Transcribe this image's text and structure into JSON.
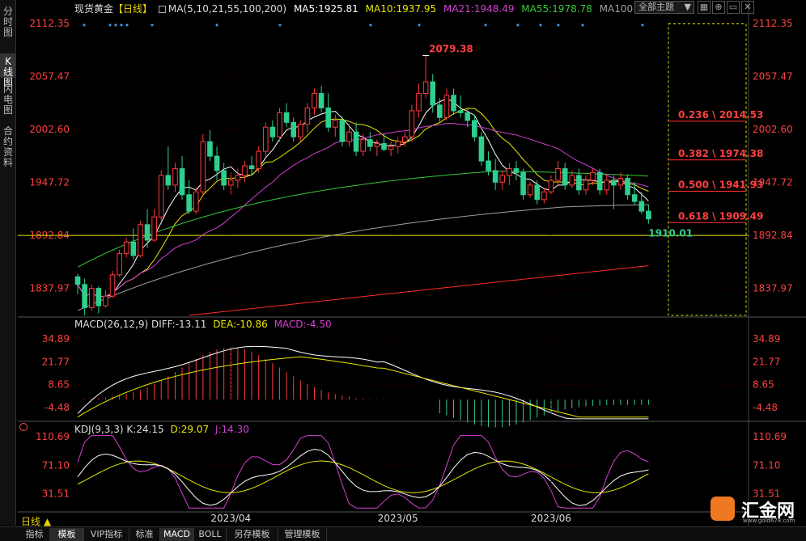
{
  "left_tabs": [
    {
      "label": "分时图",
      "active": false
    },
    {
      "label": "K线图",
      "active": true
    },
    {
      "label": "闪电图",
      "active": false
    },
    {
      "label": "合约资料",
      "active": false
    }
  ],
  "legend": {
    "symbol": "现货黄金",
    "period": "【日线】",
    "ma_title": "MA(5,10,21,55,100,200)",
    "ma5": "MA5:1925.81",
    "ma10": "MA10:1937.95",
    "ma21": "MA21:1948.49",
    "ma55": "MA55:1978.78",
    "ma100": "MA100"
  },
  "toolbar": {
    "theme_select": "全部主题",
    "icons": [
      "grid-icon",
      "expand-icon",
      "minimize-icon",
      "close-icon"
    ]
  },
  "main_panel": {
    "y_ticks": [
      "2112.35",
      "2057.47",
      "2002.60",
      "1947.72",
      "1892.84",
      "1837.97"
    ],
    "high_label": "2079.38",
    "low_label": "1910.01",
    "fib_levels": [
      {
        "label": "0.236 \\ 2014.53",
        "value": 2014.53
      },
      {
        "label": "0.382 \\ 1974.38",
        "value": 1974.38
      },
      {
        "label": "0.500 \\ 1941.93",
        "value": 1941.93
      },
      {
        "label": "0.618 \\ 1909.49",
        "value": 1909.49
      }
    ],
    "horizontal_line": 1892.84
  },
  "macd_panel": {
    "title": "MACD(26,12,9)",
    "diff": "DIFF:-13.11",
    "dea": "DEA:-10.86",
    "macd": "MACD:-4.50",
    "y_ticks": [
      "34.89",
      "21.77",
      "8.65",
      "-4.48"
    ]
  },
  "kdj_panel": {
    "title": "KDJ(9,3,3)",
    "k": "K:24.15",
    "d": "D:29.07",
    "j": "J:14.30",
    "y_ticks": [
      "110.69",
      "71.10",
      "31.51"
    ]
  },
  "x_axis": [
    "2023/04",
    "2023/05",
    "2023/06"
  ],
  "period_label": "日线 ▲",
  "bottom_tabs": [
    {
      "label": "指标",
      "active": false
    },
    {
      "label": "模板",
      "active": true
    },
    {
      "label": "VIP指标",
      "active": false
    },
    {
      "label": "标准",
      "active": false
    },
    {
      "label": "MACD",
      "active": true
    },
    {
      "label": "BOLL",
      "active": false
    },
    {
      "label": "另存模板",
      "active": false
    },
    {
      "label": "管理模板",
      "active": false
    }
  ],
  "logo": {
    "text": "汇金网",
    "url": "www.gold678.com"
  },
  "colors": {
    "up": "#ff3b3b",
    "down": "#2fcf8f",
    "ma5": "#ffffff",
    "ma10": "#e8e800",
    "ma21": "#d43fd4",
    "ma55": "#38c838",
    "ma100": "#a0a0a0",
    "ma200": "#ff2a2a",
    "fib": "#e8e800",
    "label_red": "#ff4040",
    "axis_red": "#ff4040"
  },
  "chart_data": {
    "type": "candlestick",
    "ohlc": [
      [
        1850,
        1853,
        1832,
        1842
      ],
      [
        1842,
        1848,
        1810,
        1818
      ],
      [
        1818,
        1842,
        1815,
        1838
      ],
      [
        1838,
        1840,
        1812,
        1820
      ],
      [
        1820,
        1836,
        1818,
        1830
      ],
      [
        1830,
        1856,
        1828,
        1852
      ],
      [
        1852,
        1878,
        1850,
        1874
      ],
      [
        1874,
        1890,
        1870,
        1886
      ],
      [
        1886,
        1900,
        1868,
        1872
      ],
      [
        1872,
        1908,
        1870,
        1904
      ],
      [
        1904,
        1920,
        1880,
        1888
      ],
      [
        1888,
        1920,
        1886,
        1912
      ],
      [
        1912,
        1960,
        1908,
        1955
      ],
      [
        1955,
        1985,
        1940,
        1945
      ],
      [
        1945,
        1968,
        1938,
        1962
      ],
      [
        1962,
        1975,
        1930,
        1935
      ],
      [
        1935,
        1950,
        1915,
        1918
      ],
      [
        1918,
        1942,
        1915,
        1938
      ],
      [
        1938,
        1998,
        1935,
        1990
      ],
      [
        1990,
        2002,
        1970,
        1975
      ],
      [
        1975,
        1985,
        1950,
        1960
      ],
      [
        1960,
        1968,
        1940,
        1945
      ],
      [
        1945,
        1958,
        1935,
        1950
      ],
      [
        1950,
        1962,
        1942,
        1955
      ],
      [
        1955,
        1970,
        1948,
        1965
      ],
      [
        1965,
        1975,
        1955,
        1962
      ],
      [
        1962,
        1985,
        1958,
        1980
      ],
      [
        1980,
        2010,
        1975,
        2005
      ],
      [
        2005,
        2012,
        1990,
        1995
      ],
      [
        1995,
        2025,
        1990,
        2020
      ],
      [
        2020,
        2030,
        2005,
        2010
      ],
      [
        2010,
        2015,
        1990,
        1995
      ],
      [
        1995,
        2012,
        1990,
        2008
      ],
      [
        2008,
        2030,
        2000,
        2025
      ],
      [
        2025,
        2045,
        2018,
        2040
      ],
      [
        2040,
        2048,
        2020,
        2025
      ],
      [
        2025,
        2040,
        2000,
        2005
      ],
      [
        2005,
        2018,
        1995,
        2012
      ],
      [
        2012,
        2016,
        1985,
        1990
      ],
      [
        1990,
        2008,
        1985,
        2000
      ],
      [
        2000,
        2010,
        1975,
        1980
      ],
      [
        1980,
        1998,
        1975,
        1992
      ],
      [
        1992,
        2000,
        1980,
        1985
      ],
      [
        1985,
        1992,
        1975,
        1988
      ],
      [
        1988,
        1998,
        1980,
        1982
      ],
      [
        1982,
        1990,
        1975,
        1985
      ],
      [
        1985,
        1995,
        1978,
        1990
      ],
      [
        1990,
        2000,
        1985,
        1995
      ],
      [
        1995,
        2028,
        1990,
        2022
      ],
      [
        2022,
        2050,
        2015,
        2040
      ],
      [
        2040,
        2079,
        2035,
        2052
      ],
      [
        2052,
        2060,
        2020,
        2028
      ],
      [
        2028,
        2035,
        2010,
        2015
      ],
      [
        2015,
        2045,
        2012,
        2038
      ],
      [
        2038,
        2045,
        2018,
        2022
      ],
      [
        2022,
        2038,
        2015,
        2020
      ],
      [
        2020,
        2025,
        2005,
        2012
      ],
      [
        2012,
        2018,
        1990,
        1995
      ],
      [
        1995,
        2000,
        1965,
        1970
      ],
      [
        1970,
        1980,
        1955,
        1960
      ],
      [
        1960,
        1972,
        1940,
        1948
      ],
      [
        1948,
        1960,
        1940,
        1955
      ],
      [
        1955,
        1968,
        1945,
        1962
      ],
      [
        1962,
        1970,
        1950,
        1958
      ],
      [
        1958,
        1962,
        1930,
        1935
      ],
      [
        1935,
        1948,
        1932,
        1945
      ],
      [
        1945,
        1950,
        1925,
        1930
      ],
      [
        1930,
        1942,
        1926,
        1938
      ],
      [
        1938,
        1955,
        1935,
        1950
      ],
      [
        1950,
        1970,
        1945,
        1962
      ],
      [
        1962,
        1968,
        1940,
        1945
      ],
      [
        1945,
        1960,
        1942,
        1955
      ],
      [
        1955,
        1962,
        1935,
        1940
      ],
      [
        1940,
        1955,
        1935,
        1950
      ],
      [
        1950,
        1962,
        1945,
        1958
      ],
      [
        1958,
        1962,
        1935,
        1940
      ],
      [
        1940,
        1955,
        1935,
        1950
      ],
      [
        1950,
        1955,
        1920,
        1945
      ],
      [
        1945,
        1958,
        1940,
        1952
      ],
      [
        1952,
        1956,
        1930,
        1935
      ],
      [
        1935,
        1948,
        1925,
        1928
      ],
      [
        1928,
        1938,
        1915,
        1918
      ],
      [
        1918,
        1925,
        1905,
        1910
      ]
    ],
    "ma_series": [
      {
        "name": "MA5",
        "color": "#ffffff"
      },
      {
        "name": "MA10",
        "color": "#e8e800"
      },
      {
        "name": "MA21",
        "color": "#d43fd4"
      },
      {
        "name": "MA55",
        "color": "#38c838"
      },
      {
        "name": "MA100",
        "color": "#a0a0a0"
      }
    ],
    "ylim": [
      1810,
      2120
    ],
    "x_ticks": [
      {
        "label": "2023/04",
        "index": 22
      },
      {
        "label": "2023/05",
        "index": 46
      },
      {
        "label": "2023/06",
        "index": 68
      }
    ]
  }
}
